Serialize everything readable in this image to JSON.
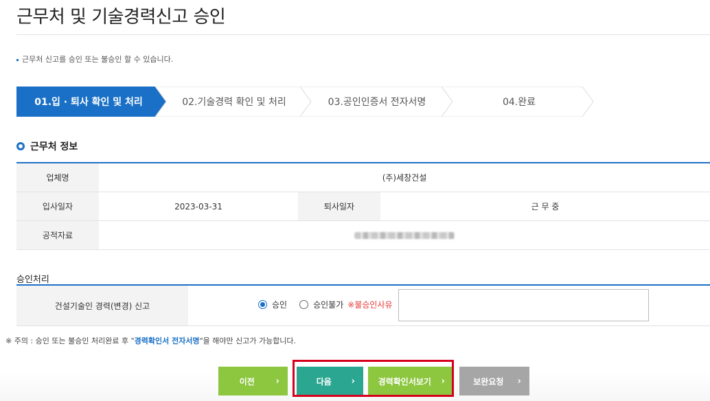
{
  "page": {
    "title": "근무처 및 기술경력신고 승인",
    "note": "근무처 신고를 승인 또는 불승인 할 수 있습니다."
  },
  "steps": [
    {
      "label": "01.입 · 퇴사 확인 및 처리",
      "active": true
    },
    {
      "label": "02.기술경력 확인 및 처리",
      "active": false
    },
    {
      "label": "03.공인인증서 전자서명",
      "active": false
    },
    {
      "label": "04.완료",
      "active": false
    }
  ],
  "workplace": {
    "section_title": "근무처 정보",
    "company_label": "업체명",
    "company_value": "(주)세창건설",
    "join_label": "입사일자",
    "join_value": "2023-03-31",
    "leave_label": "퇴사일자",
    "leave_value": "근 무 중",
    "doc_label": "공적자료"
  },
  "approval": {
    "section_title": "승인처리",
    "row_label": "건설기술인 경력(변경) 신고",
    "option_approve": "승인",
    "option_reject": "승인불가",
    "reject_reason": "※불승인사유",
    "selected": "approve"
  },
  "warning": {
    "prefix": "※ 주의 : 승인 또는 불승인 처리완료 후 \"",
    "highlight": "경력확인서 전자서명",
    "suffix": "\"을 해야만 신고가 가능합니다."
  },
  "buttons": {
    "prev": "이전",
    "next": "다음",
    "view": "경력확인서보기",
    "supplement": "보완요청",
    "chevron": "›"
  },
  "colors": {
    "accent_blue": "#1a70c6",
    "step_active": "#1a70c6",
    "btn_green": "#8dc63f",
    "btn_teal": "#2ba690",
    "btn_gray": "#a6a6a6",
    "highlight_red": "#d6001c",
    "reject_red": "#e53935"
  }
}
